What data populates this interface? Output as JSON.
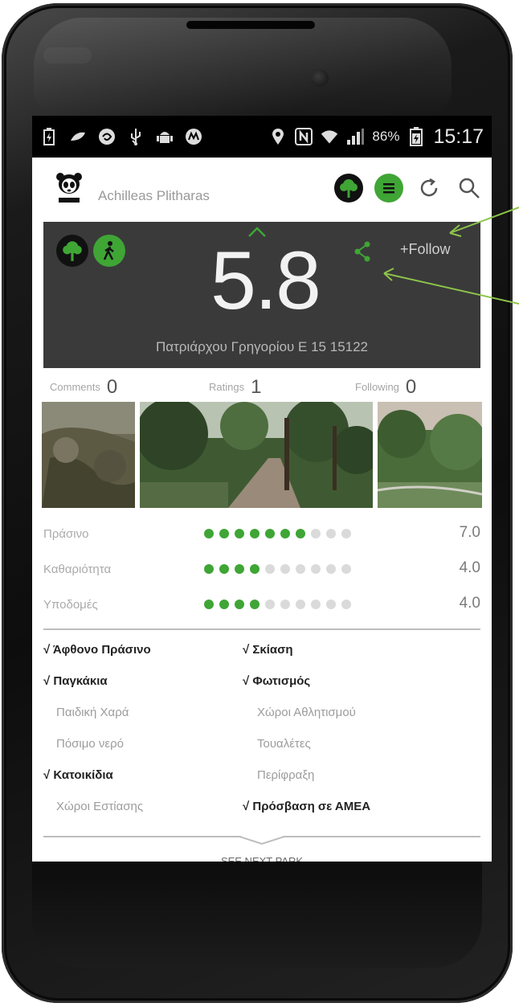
{
  "status_bar": {
    "battery_percent": "86%",
    "time": "15:17",
    "icons": [
      "battery-icon",
      "leaf-icon",
      "swirl-icon",
      "usb-icon",
      "android-icon",
      "motorola-icon",
      "location-icon",
      "nfc-icon",
      "wifi-icon",
      "signal-icon",
      "battery-charging-icon"
    ]
  },
  "header": {
    "logo": "wwf-panda-logo",
    "user_name": "Achilleas Plitharas",
    "icons": [
      "tree-icon",
      "menu-icon",
      "refresh-icon",
      "search-icon"
    ]
  },
  "score_panel": {
    "score": "5.8",
    "follow_label": "+Follow",
    "address": "Πατριάρχου Γρηγορίου Ε 15 15122",
    "icons": [
      "tree-icon",
      "walk-icon",
      "chevron-up-icon",
      "share-icon"
    ]
  },
  "counters": [
    {
      "label": "Comments",
      "value": "0"
    },
    {
      "label": "Ratings",
      "value": "1"
    },
    {
      "label": "Following",
      "value": "0"
    }
  ],
  "ratings": [
    {
      "label": "Πράσινο",
      "score": 7,
      "max": 10,
      "value": "7.0"
    },
    {
      "label": "Καθαριότητα",
      "score": 4,
      "max": 10,
      "value": "4.0"
    },
    {
      "label": "Υποδομές",
      "score": 4,
      "max": 10,
      "value": "4.0"
    }
  ],
  "features": [
    [
      {
        "label": "√ Άφθονο Πράσινο",
        "checked": true
      },
      {
        "label": "√ Σκίαση",
        "checked": true
      }
    ],
    [
      {
        "label": "√ Παγκάκια",
        "checked": true
      },
      {
        "label": "√ Φωτισμός",
        "checked": true
      }
    ],
    [
      {
        "label": "Παιδική Χαρά",
        "checked": false
      },
      {
        "label": "Χώροι Αθλητισμού",
        "checked": false
      }
    ],
    [
      {
        "label": "Πόσιμο νερό",
        "checked": false
      },
      {
        "label": "Τουαλέτες",
        "checked": false
      }
    ],
    [
      {
        "label": "√ Κατοικίδια",
        "checked": true
      },
      {
        "label": "Περίφραξη",
        "checked": false
      }
    ],
    [
      {
        "label": "Χώροι Εστίασης",
        "checked": false
      },
      {
        "label": "√ Πρόσβαση σε ΑΜΕΑ",
        "checked": true
      }
    ]
  ],
  "next_label": "SEE NEXT PARK",
  "colors": {
    "accent_green": "#3fa535",
    "panel_dark": "#3a3a3a",
    "annotation_green": "#8dc44a"
  }
}
